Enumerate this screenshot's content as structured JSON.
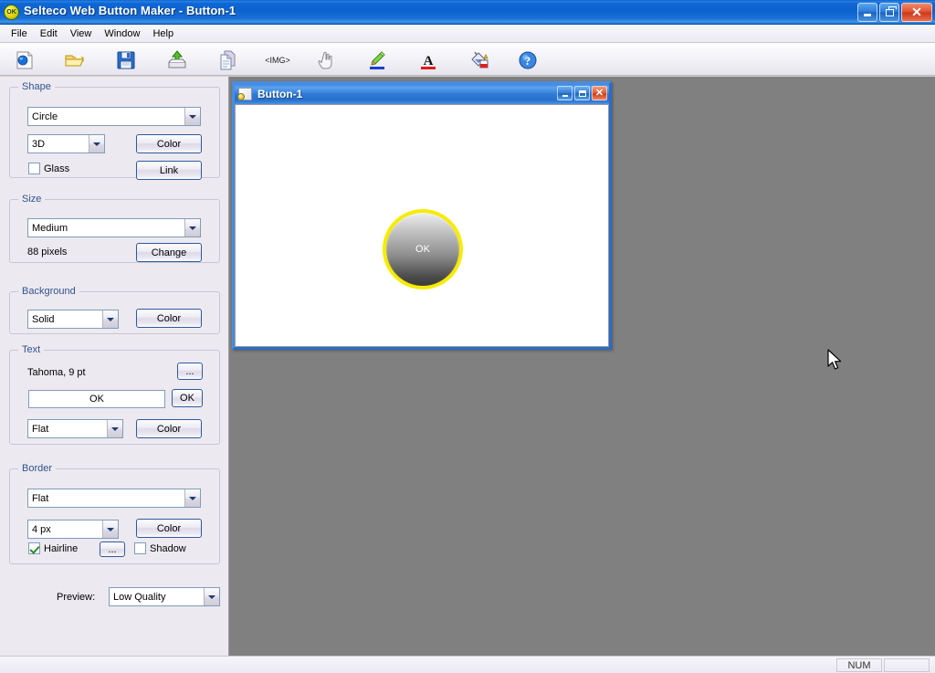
{
  "window": {
    "title": "Selteco Web Button Maker - Button-1",
    "app_icon": "ok-circle-icon",
    "controls": {
      "minimize": "minimize-icon",
      "restore": "restore-icon",
      "close": "close-icon"
    }
  },
  "menu": {
    "items": [
      {
        "label": "File"
      },
      {
        "label": "Edit"
      },
      {
        "label": "View"
      },
      {
        "label": "Window"
      },
      {
        "label": "Help"
      }
    ]
  },
  "toolbar": {
    "buttons": [
      {
        "name": "new-button",
        "icon": "new-document-icon",
        "label": ""
      },
      {
        "name": "open-button",
        "icon": "open-folder-icon",
        "label": ""
      },
      {
        "name": "save-button",
        "icon": "floppy-disk-icon",
        "label": ""
      },
      {
        "name": "export-button",
        "icon": "export-down-icon",
        "label": ""
      },
      {
        "name": "copy-button",
        "icon": "copy-pages-icon",
        "label": ""
      },
      {
        "name": "img-tag-button",
        "icon": "img-tag-icon",
        "label": "<IMG>"
      },
      {
        "name": "hand-tool-button",
        "icon": "hand-pointer-icon",
        "label": ""
      },
      {
        "name": "shape-color-button",
        "icon": "pencil-icon",
        "label": ""
      },
      {
        "name": "text-color-button",
        "icon": "underlined-a-icon",
        "label": "A"
      },
      {
        "name": "background-color-button",
        "icon": "paint-bucket-icon",
        "label": ""
      },
      {
        "name": "help-button",
        "icon": "question-help-icon",
        "label": ""
      }
    ]
  },
  "panel": {
    "shape": {
      "title": "Shape",
      "style_value": "Circle",
      "effect_value": "3D",
      "color_label": "Color",
      "link_label": "Link",
      "glass_label": "Glass",
      "glass_checked": false
    },
    "size": {
      "title": "Size",
      "preset_value": "Medium",
      "pixels_label": "88 pixels",
      "change_label": "Change"
    },
    "background": {
      "title": "Background",
      "fill_value": "Solid",
      "color_label": "Color"
    },
    "text": {
      "title": "Text",
      "font_label": "Tahoma, 9 pt",
      "font_browse_label": "...",
      "caption_value": "OK",
      "caption_apply_label": "OK",
      "style_value": "Flat",
      "color_label": "Color"
    },
    "border": {
      "title": "Border",
      "style_value": "Flat",
      "width_value": "4 px",
      "color_label": "Color",
      "hairline_label": "Hairline",
      "hairline_checked": true,
      "hairline_browse_label": "...",
      "shadow_label": "Shadow",
      "shadow_checked": false
    },
    "preview": {
      "label": "Preview:",
      "quality_value": "Low Quality"
    }
  },
  "child_window": {
    "title": "Button-1",
    "icon": "button-document-icon",
    "controls": {
      "minimize": "minimize-icon",
      "maximize": "maximize-icon",
      "close": "close-icon"
    },
    "button_preview": {
      "caption": "OK",
      "shape": "circle",
      "size_px": "88",
      "border_color": "#f5ec00",
      "border_width_px": "4",
      "text_color": "#ffffff",
      "fill_top": "#eeeeee",
      "fill_bottom": "#3a3a3a"
    }
  },
  "statusbar": {
    "message": "",
    "indicators": [
      "NUM"
    ]
  }
}
